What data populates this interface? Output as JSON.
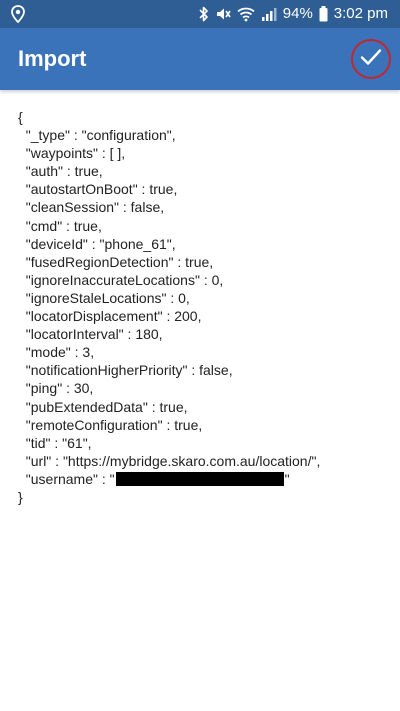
{
  "status_bar": {
    "battery_percent": "94%",
    "time": "3:02 pm",
    "icons": [
      "location-icon",
      "bluetooth-icon",
      "mute-icon",
      "wifi-icon",
      "signal-icon",
      "battery-icon"
    ]
  },
  "app_bar": {
    "title": "Import",
    "confirm_icon": "checkmark-icon",
    "highlight_color": "#c1272d"
  },
  "config_json": {
    "lines": [
      "{",
      "  \"_type\" : \"configuration\",",
      "  \"waypoints\" : [ ],",
      "  \"auth\" : true,",
      "  \"autostartOnBoot\" : true,",
      "  \"cleanSession\" : false,",
      "  \"cmd\" : true,",
      "  \"deviceId\" : \"phone_61\",",
      "  \"fusedRegionDetection\" : true,",
      "  \"ignoreInaccurateLocations\" : 0,",
      "  \"ignoreStaleLocations\" : 0,",
      "  \"locatorDisplacement\" : 200,",
      "  \"locatorInterval\" : 180,",
      "  \"mode\" : 3,",
      "  \"notificationHigherPriority\" : false,",
      "  \"ping\" : 30,",
      "  \"pubExtendedData\" : true,",
      "  \"remoteConfiguration\" : true,",
      "  \"tid\" : \"61\",",
      "  \"url\" : \"https://mybridge.skaro.com.au/location/\","
    ],
    "username_prefix": "  \"username\" : \"",
    "username_suffix": "\"",
    "closing": "}"
  }
}
